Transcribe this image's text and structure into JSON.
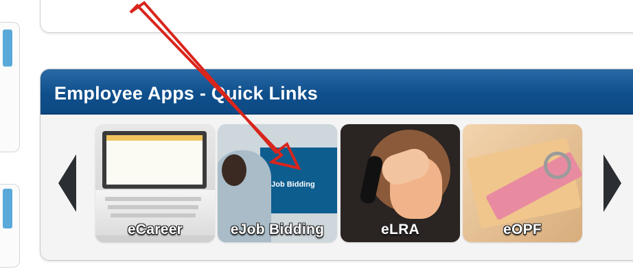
{
  "widget": {
    "title": "Employee Apps - Quick Links",
    "header_color": "#0f4f8c"
  },
  "tiles": [
    {
      "label": "eCareer",
      "icon": "laptop-icon"
    },
    {
      "label": "eJob Bidding",
      "icon": "job-board-icon",
      "inner_text": "eJob Bidding"
    },
    {
      "label": "eLRA",
      "icon": "phone-call-icon"
    },
    {
      "label": "eOPF",
      "icon": "folder-icon"
    }
  ],
  "navigation": {
    "prev_icon": "triangle-left-icon",
    "next_icon": "triangle-right-icon"
  },
  "annotation": {
    "color": "#d9251c",
    "icon": "red-arrow-annotation"
  },
  "sidebar": {
    "accent": "#59a9d9"
  }
}
